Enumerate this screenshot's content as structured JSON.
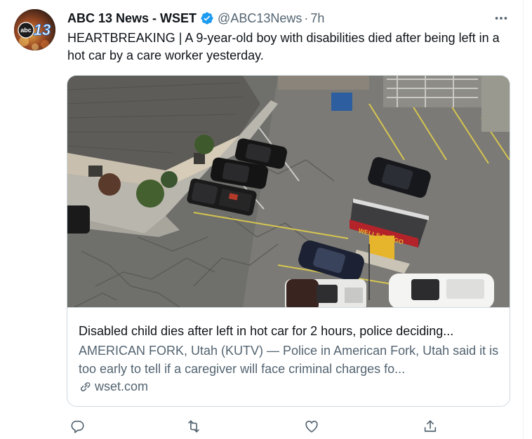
{
  "tweet": {
    "author_name": "ABC 13 News - WSET",
    "handle": "@ABC13News",
    "separator": "·",
    "time": "7h",
    "text": "HEARTBREAKING | A 9-year-old boy with disabilities died after being left in a hot car by a care worker yesterday.",
    "avatar": {
      "logo_text": "abc",
      "logo_number": "13"
    }
  },
  "card": {
    "title": "Disabled child dies after left in hot car for 2 hours, police deciding...",
    "description": "AMERICAN FORK, Utah (KUTV) — Police in American Fork, Utah said it is too early to tell if a caregiver will face criminal charges fo...",
    "domain": "wset.com",
    "image_signage": "WELLS FARGO"
  },
  "icons": {
    "verified": "verified-badge-icon",
    "more": "more-horizontal-icon",
    "reply": "reply-icon",
    "retweet": "retweet-icon",
    "like": "like-heart-icon",
    "share": "share-icon",
    "link": "link-icon"
  },
  "colors": {
    "text_primary": "#0f1419",
    "text_secondary": "#536471",
    "verified_blue": "#1d9bf0",
    "border": "#cfd9de",
    "signage_red": "#b4232a",
    "signage_gold": "#e7b52b"
  }
}
